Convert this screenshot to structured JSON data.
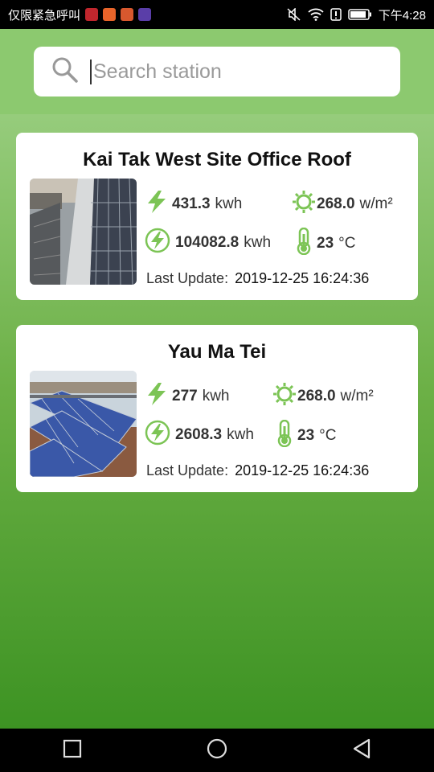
{
  "status_bar": {
    "left_text": "仅限紧急呼叫",
    "time": "下午4:28",
    "app_colors": [
      "#c0262d",
      "#e8642a",
      "#d8582e",
      "#5a3ea8"
    ]
  },
  "search": {
    "placeholder": "Search station",
    "value": ""
  },
  "colors": {
    "accent": "#7cc455",
    "header": "#8cc96f"
  },
  "stations": [
    {
      "name": "Kai Tak West Site Office Roof",
      "energy_today_value": "431.3",
      "energy_today_unit": "kwh",
      "irradiance_value": "268.0",
      "irradiance_unit": "w/m²",
      "energy_total_value": "104082.8",
      "energy_total_unit": "kwh",
      "temperature_value": "23",
      "temperature_unit": "°C",
      "last_update_label": "Last Update:",
      "last_update": "2019-12-25 16:24:36"
    },
    {
      "name": "Yau Ma Tei",
      "energy_today_value": "277",
      "energy_today_unit": "kwh",
      "irradiance_value": "268.0",
      "irradiance_unit": "w/m²",
      "energy_total_value": "2608.3",
      "energy_total_unit": "kwh",
      "temperature_value": "23",
      "temperature_unit": "°C",
      "last_update_label": "Last Update:",
      "last_update": "2019-12-25 16:24:36"
    }
  ]
}
